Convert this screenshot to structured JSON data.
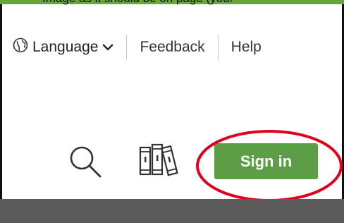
{
  "top_banner": {
    "text": "Image as it should be on page (your"
  },
  "utility_nav": {
    "language_label": "Language",
    "feedback_label": "Feedback",
    "help_label": "Help"
  },
  "header": {
    "search_icon": "search-icon",
    "library_icon": "library-icon",
    "signin_label": "Sign in"
  },
  "colors": {
    "accent_green": "#5c9d45",
    "top_bar_green": "#68a63a",
    "highlight_red": "#e0001b",
    "bottom_bar": "#5a5a5a"
  }
}
